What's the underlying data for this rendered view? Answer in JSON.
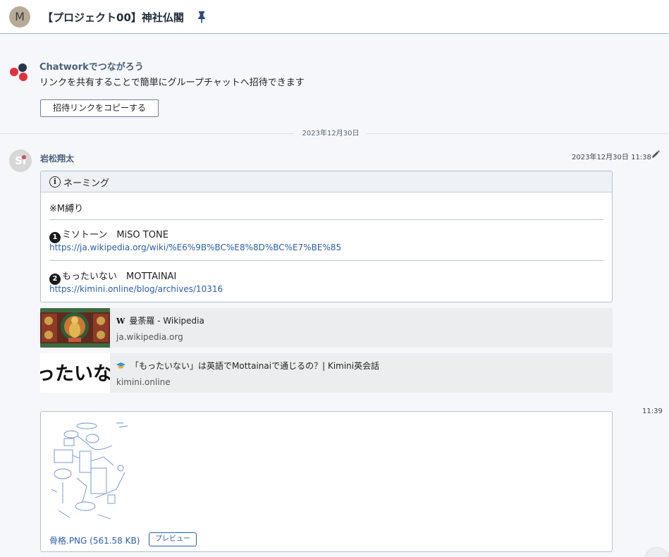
{
  "header": {
    "room_icon_letter": "M",
    "room_title": "【プロジェクト00】神社仏閣"
  },
  "invite": {
    "title": "Chatworkでつながろう",
    "text": "リンクを共有することで簡単にグループチャットへ招待できます",
    "button_label": "招待リンクをコピーする"
  },
  "timeline": {
    "date_divider": "2023年12月30日"
  },
  "message": {
    "avatar_initials": "Si",
    "sender": "岩松翔太",
    "timestamp": "2023年12月30日 11:38",
    "info": {
      "title": "ネーミング",
      "note": "※M縛り",
      "entries": [
        {
          "num": "1",
          "title": "ミソトーン　MiSO TONE",
          "url": "https://ja.wikipedia.org/wiki/%E6%9B%BC%E8%8D%BC%E7%BE%85"
        },
        {
          "num": "2",
          "title": "もったいない　MOTTAINAI",
          "url": "https://kimini.online/blog/archives/10316"
        }
      ]
    },
    "previews": [
      {
        "favicon": "W",
        "title": "曼荼羅 - Wikipedia",
        "domain": "ja.wikipedia.org",
        "thumb_text": ""
      },
      {
        "favicon": "kimini-icon",
        "title": "「もったいない」は英語でMottainaiで通じるの？| Kimini英会話",
        "domain": "kimini.online",
        "thumb_text": "ったいな"
      }
    ]
  },
  "file_message": {
    "time": "11:39",
    "file_name": "骨格.PNG (561.58 KB)",
    "preview_label": "プレビュー"
  },
  "colors": {
    "accent_blue": "#2c5ea8",
    "name_blue": "#4a6079",
    "logo_red": "#e2313c",
    "logo_dark": "#27364a"
  }
}
